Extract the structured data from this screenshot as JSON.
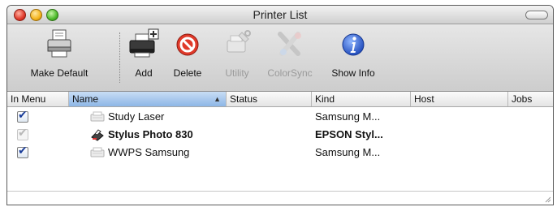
{
  "window": {
    "title": "Printer List"
  },
  "toolbar": {
    "items": [
      {
        "label": "Make Default",
        "enabled": true,
        "icon": "printer-default-icon"
      },
      {
        "label": "Add",
        "enabled": true,
        "icon": "add-printer-icon"
      },
      {
        "label": "Delete",
        "enabled": true,
        "icon": "delete-icon"
      },
      {
        "label": "Utility",
        "enabled": false,
        "icon": "utility-icon"
      },
      {
        "label": "ColorSync",
        "enabled": false,
        "icon": "colorsync-icon"
      },
      {
        "label": "Show Info",
        "enabled": true,
        "icon": "info-icon"
      }
    ]
  },
  "table": {
    "columns": [
      {
        "label": "In Menu"
      },
      {
        "label": "Name",
        "sorted": true
      },
      {
        "label": "Status"
      },
      {
        "label": "Kind"
      },
      {
        "label": "Host"
      },
      {
        "label": "Jobs"
      }
    ],
    "rows": [
      {
        "in_menu": true,
        "enabled": true,
        "name": "Study Laser",
        "status": "",
        "kind": "Samsung M...",
        "host": "",
        "jobs": "",
        "bold": false,
        "icon": "laser-printer-icon"
      },
      {
        "in_menu": true,
        "enabled": false,
        "name": "Stylus Photo 830",
        "status": "",
        "kind": "EPSON Styl...",
        "host": "",
        "jobs": "",
        "bold": true,
        "icon": "inkjet-printer-icon"
      },
      {
        "in_menu": true,
        "enabled": true,
        "name": "WWPS Samsung",
        "status": "",
        "kind": "Samsung M...",
        "host": "",
        "jobs": "",
        "bold": false,
        "icon": "laser-printer-icon"
      }
    ]
  },
  "colors": {
    "accent": "#1b3e9a",
    "sorted_header": "#8db6e6",
    "delete_red": "#d42020",
    "info_blue": "#1f55c7"
  }
}
